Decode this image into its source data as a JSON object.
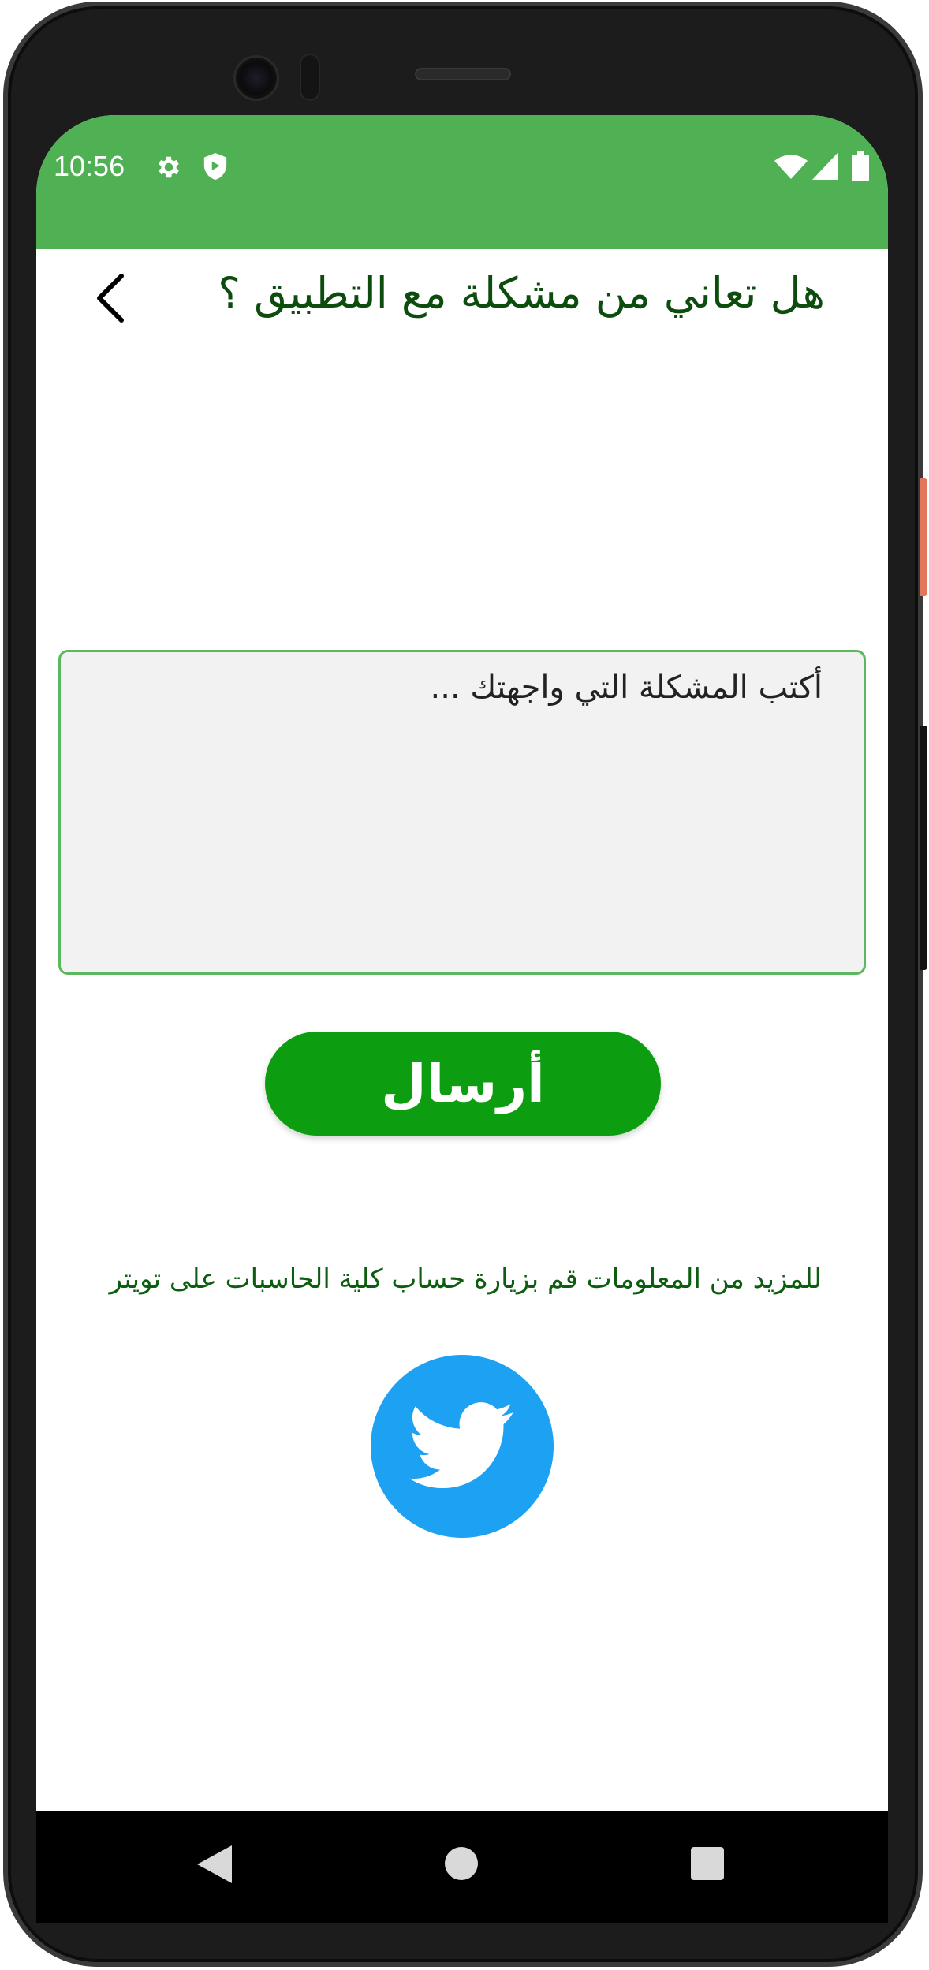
{
  "status_bar": {
    "time": "10:56",
    "color": "#50b154",
    "icons": [
      "settings-icon",
      "shield-icon",
      "wifi-icon",
      "signal-icon",
      "battery-icon"
    ]
  },
  "header": {
    "title": "هل تعاني من مشكلة مع التطبيق ؟",
    "back_icon": "chevron-left-icon"
  },
  "form": {
    "placeholder": "أكتب المشكلة التي واجهتك ...",
    "value": "",
    "send_label": "أرسال"
  },
  "info": {
    "text": "للمزيد من المعلومات قم بزيارة حساب كلية الحاسبات على تويتر",
    "social_icon": "twitter-icon"
  },
  "nav_bar": {
    "icons": [
      "back-triangle-icon",
      "home-circle-icon",
      "recents-square-icon"
    ]
  },
  "colors": {
    "accent": "#50b154",
    "button": "#0c9e10",
    "title_text": "#0c4d0e",
    "twitter": "#1da1f2"
  }
}
